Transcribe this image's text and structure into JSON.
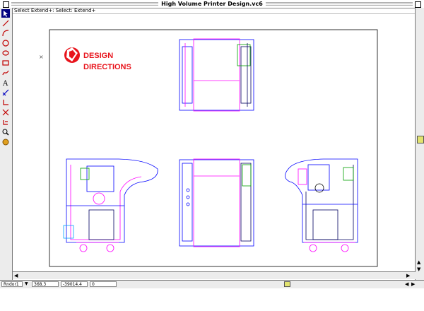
{
  "window": {
    "title": "High Volume Printer Design.vc6"
  },
  "message_bar": {
    "text": "Select Extend+: Select: Extend+"
  },
  "logo": {
    "line1": "DESIGN",
    "line2": "DIRECTIONS",
    "color": "#e8141c"
  },
  "drawing": {
    "marker": "×"
  },
  "status_bar": {
    "layer": "Rndor1",
    "x_value": "368.3",
    "y_value": "-39014.4",
    "z_value": "0"
  },
  "colors": {
    "blue": "#0000ff",
    "magenta": "#ff00ff",
    "green": "#00a000",
    "dark_navy": "#000060",
    "scroll_thumb": "#e2e36f"
  },
  "toolbar": {
    "tools": [
      "select-arrow-icon",
      "line-icon",
      "arc-icon",
      "circle-icon",
      "ellipse-icon",
      "rectangle-icon",
      "freehand-icon",
      "text-icon",
      "dimension-icon",
      "corner-icon",
      "trim-icon",
      "rotate-icon",
      "zoom-icon",
      "pan-icon"
    ]
  }
}
